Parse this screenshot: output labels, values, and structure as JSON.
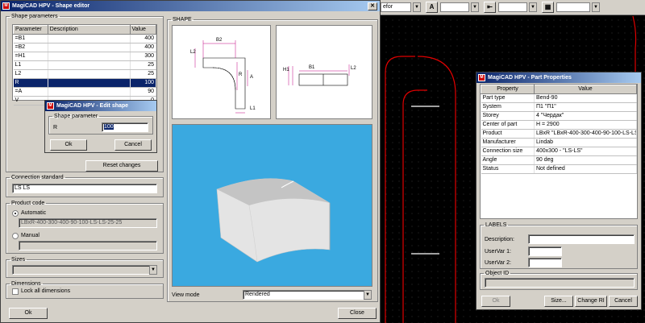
{
  "cad_toolbar": {
    "layer_text": "efor",
    "style_text": ""
  },
  "shape_editor": {
    "title": "MagiCAD HPV - Shape editor",
    "shape_parameters_legend": "Shape parameters",
    "columns": [
      "Parameter",
      "Description",
      "Value"
    ],
    "rows": [
      {
        "param": "=B1",
        "desc": "",
        "value": "400"
      },
      {
        "param": "=B2",
        "desc": "",
        "value": "400"
      },
      {
        "param": "=H1",
        "desc": "",
        "value": "300"
      },
      {
        "param": "L1",
        "desc": "",
        "value": "25"
      },
      {
        "param": "L2",
        "desc": "",
        "value": "25"
      },
      {
        "param": "R",
        "desc": "",
        "value": "100"
      },
      {
        "param": "=A",
        "desc": "",
        "value": "90"
      },
      {
        "param": "V",
        "desc": "",
        "value": "0"
      }
    ],
    "selected_row": 5,
    "reset_label": "Reset changes",
    "connection_standard_legend": "Connection standard",
    "connection_standard_value": "LS LS",
    "product_code_legend": "Product code",
    "automatic_label": "Automatic",
    "automatic_value": "LBxR-400-300-400-90-100-LS-LS-25-25",
    "manual_label": "Manual",
    "manual_value": "",
    "sizes_legend": "Sizes",
    "dimensions_legend": "Dimensions",
    "lock_label": "Lock all dimensions",
    "shape_legend": "SHAPE",
    "view_mode_label": "View mode",
    "view_mode_value": "Rendered",
    "ok_label": "Ok",
    "close_label": "Close",
    "drawing_labels": {
      "B2": "B2",
      "L2": "L2",
      "R": "R",
      "L1": "L1",
      "A": "A",
      "B1": "B1",
      "H1": "H1",
      "L2b": "L2"
    }
  },
  "edit_dialog": {
    "title": "MagiCAD HPV - Edit shape paramet...",
    "legend": "Shape parameter",
    "param_label": "R",
    "param_value": "100",
    "ok_label": "Ok",
    "cancel_label": "Cancel"
  },
  "part_properties": {
    "title": "MagiCAD HPV - Part Properties",
    "columns": [
      "Property",
      "Value"
    ],
    "rows": [
      {
        "prop": "Part type",
        "value": "Bend-90"
      },
      {
        "prop": "System",
        "value": "П1 \"П1\""
      },
      {
        "prop": "Storey",
        "value": "4 \"Чердак\""
      },
      {
        "prop": "Center of part",
        "value": "H = 2900"
      },
      {
        "prop": "Product",
        "value": "LBxR \"LBxR-400-300-400-90-100-LS-LS-25-"
      },
      {
        "prop": "Manufacturer",
        "value": "Lindab"
      },
      {
        "prop": "Connection size",
        "value": "400x300 - \"LS-LS\""
      },
      {
        "prop": "Angle",
        "value": "90 deg"
      },
      {
        "prop": "Status",
        "value": "Not defined"
      }
    ],
    "labels_legend": "LABELS",
    "description_label": "Description:",
    "uservar1_label": "UserVar 1:",
    "uservar2_label": "UserVar 2:",
    "object_id_legend": "Object ID",
    "ok_label": "Ok",
    "size_label": "Size...",
    "change_label": "Change RI",
    "cancel_label": "Cancel"
  }
}
